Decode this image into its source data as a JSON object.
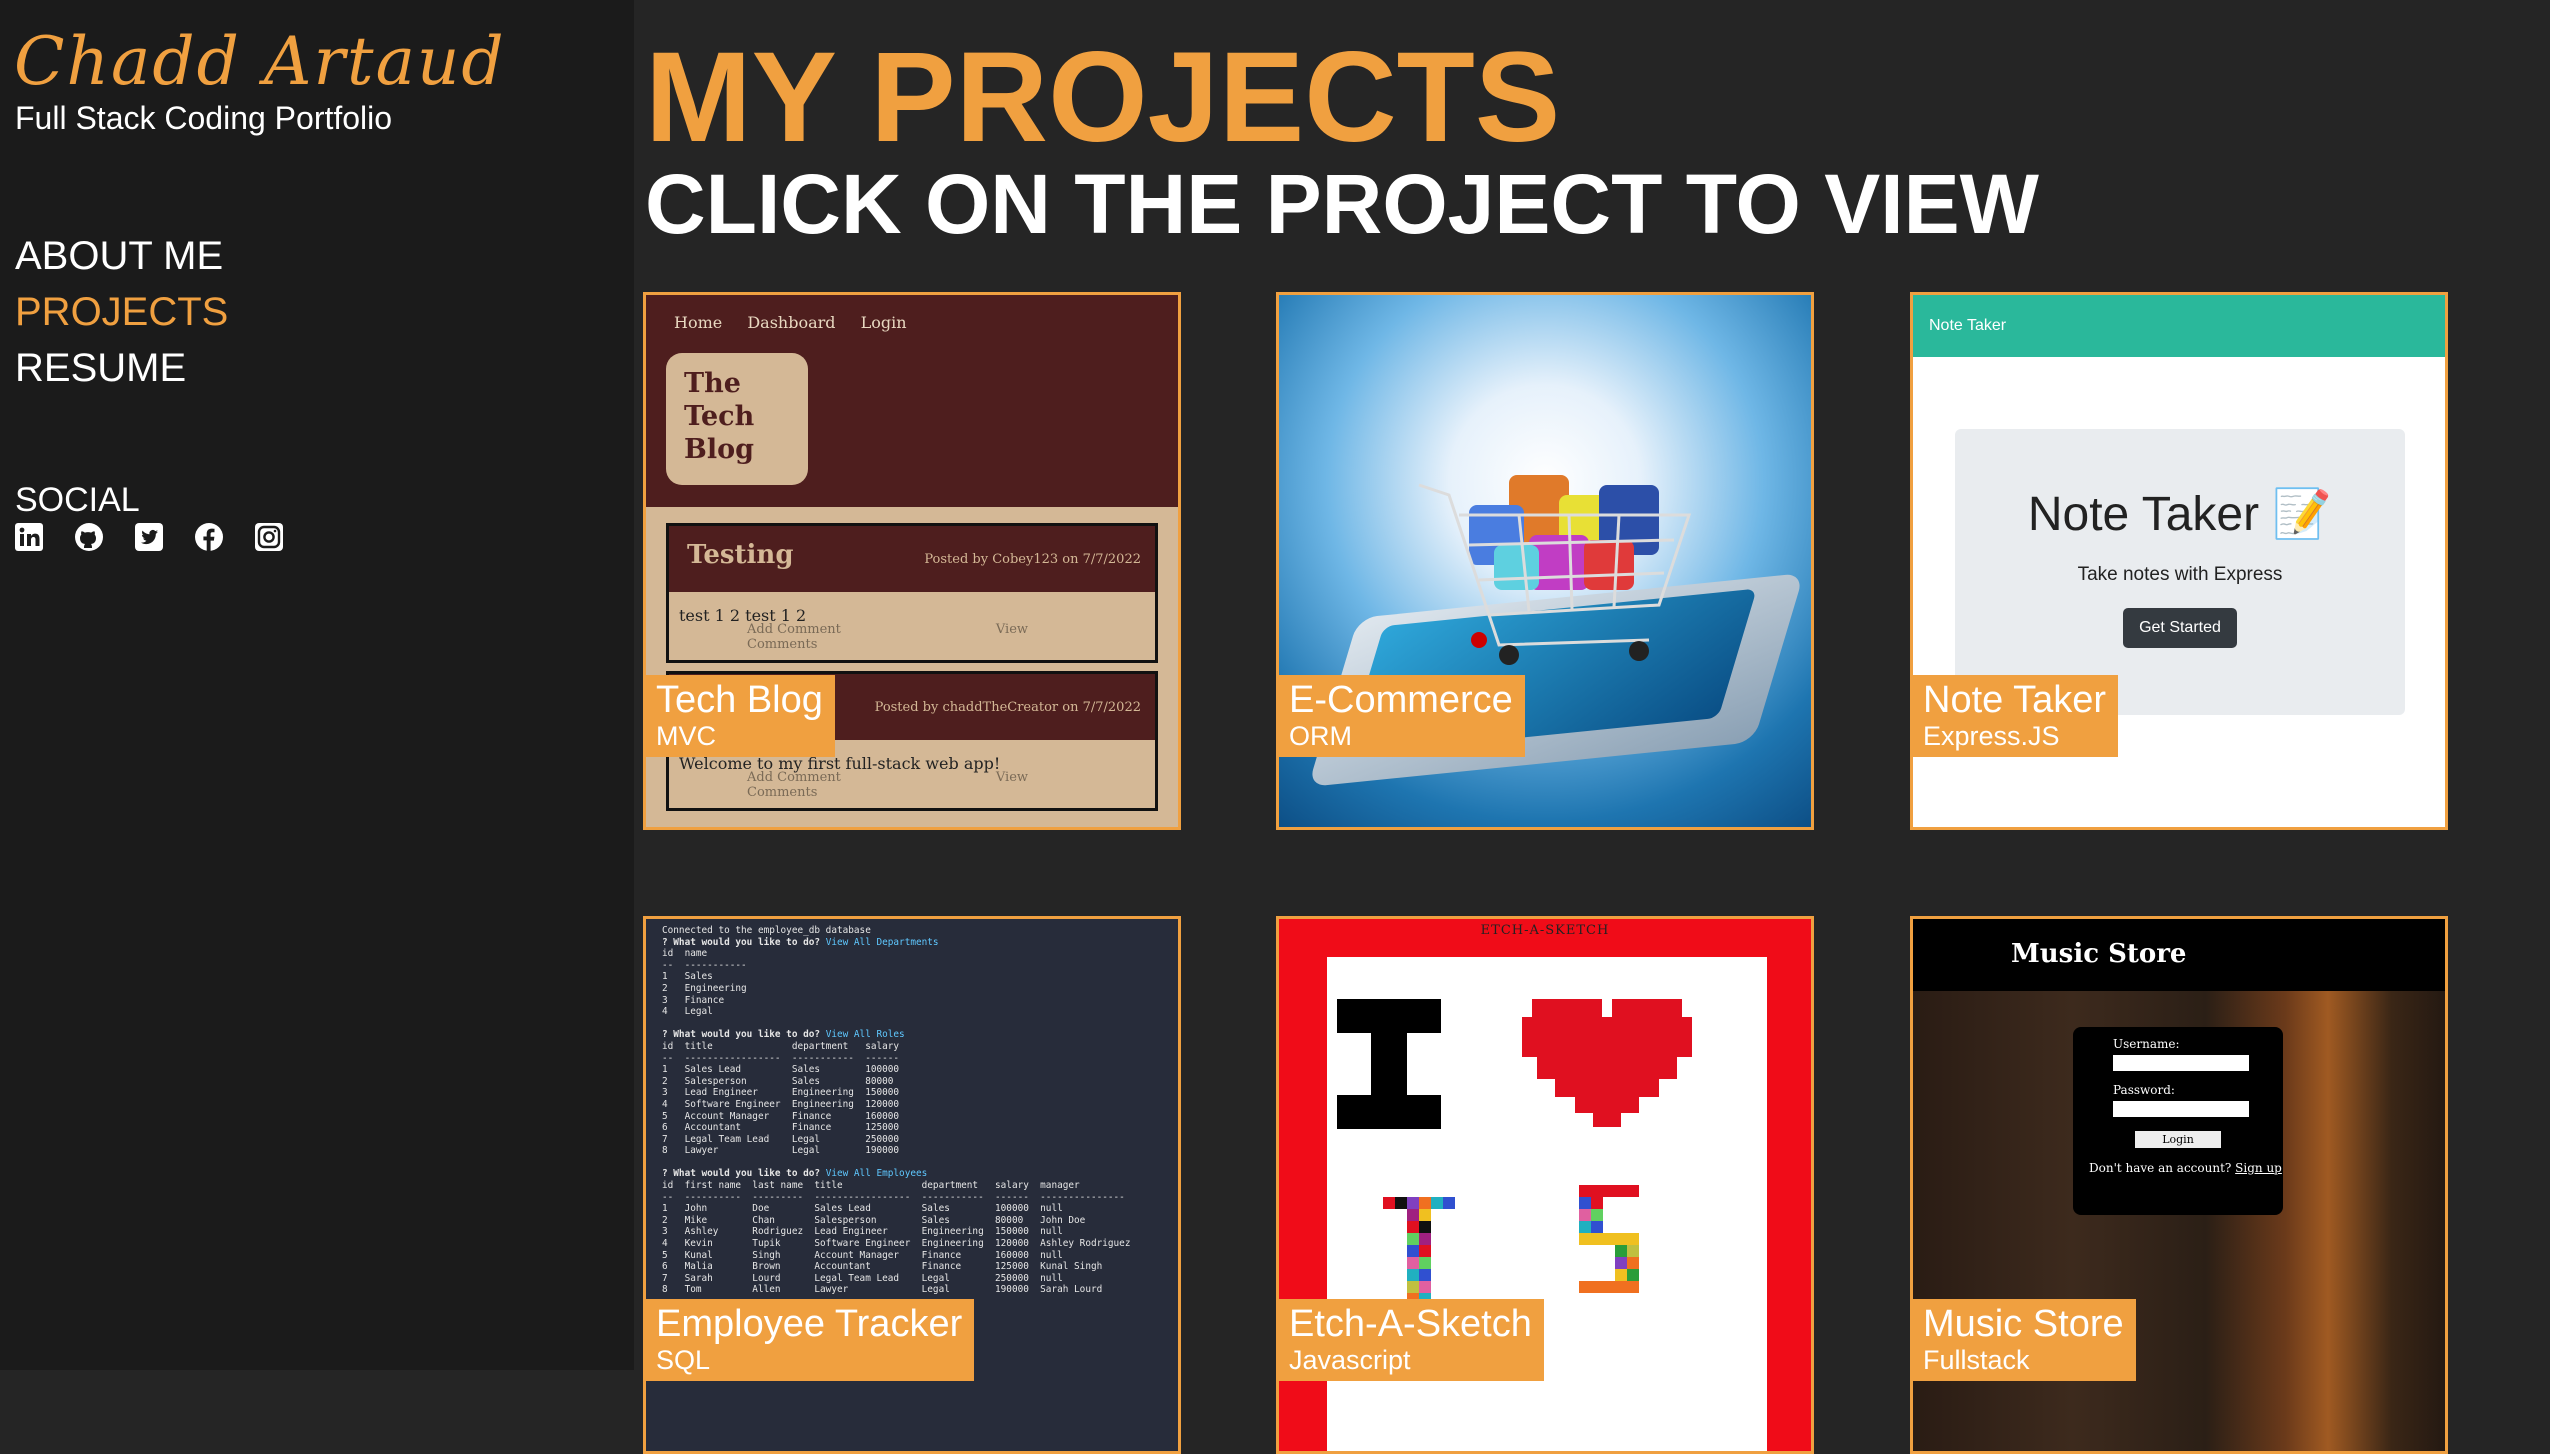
{
  "sidebar": {
    "brand_name": "Chadd Artaud",
    "tagline": "Full Stack Coding Portfolio",
    "nav": [
      {
        "label": "ABOUT ME",
        "active": false
      },
      {
        "label": "PROJECTS",
        "active": true
      },
      {
        "label": "RESUME",
        "active": false
      }
    ],
    "social_title": "SOCIAL",
    "social_icons": [
      "linkedin-icon",
      "github-icon",
      "twitter-icon",
      "facebook-icon",
      "instagram-icon"
    ]
  },
  "main": {
    "title": "MY PROJECTS",
    "subtitle": "CLICK ON THE PROJECT TO VIEW",
    "projects": [
      {
        "name": "Tech Blog",
        "tech": "MVC",
        "preview": {
          "nav": [
            "Home",
            "Dashboard",
            "Login"
          ],
          "logo": "The Tech Blog",
          "posts": [
            {
              "title": "Testing",
              "meta": "Posted by Cobey123 on 7/7/2022",
              "body": "test 1 2 test 1 2",
              "links": [
                "Add Comment",
                "View Comments"
              ]
            },
            {
              "title": "",
              "meta": "Posted by chaddTheCreator on 7/7/2022",
              "body": "Welcome to my first full-stack web app!",
              "links": [
                "Add Comment",
                "View Comments"
              ]
            }
          ]
        }
      },
      {
        "name": "E-Commerce",
        "tech": "ORM"
      },
      {
        "name": "Note Taker",
        "tech": "Express.JS",
        "preview": {
          "bar": "Note Taker",
          "heading": "Note Taker 📝",
          "text": "Take notes with Express",
          "button": "Get Started"
        }
      },
      {
        "name": "Employee Tracker",
        "tech": "SQL",
        "preview": {
          "lines": [
            "Connected to the employee_db database",
            "? What would you like to do? View All Departments",
            "id  name",
            "--  -----------",
            "1   Sales",
            "2   Engineering",
            "3   Finance",
            "4   Legal",
            "",
            "? What would you like to do? View All Roles",
            "id  title              department   salary",
            "--  -----------------  -----------  ------",
            "1   Sales Lead         Sales        100000",
            "2   Salesperson        Sales        80000",
            "3   Lead Engineer      Engineering  150000",
            "4   Software Engineer  Engineering  120000",
            "5   Account Manager    Finance      160000",
            "6   Accountant         Finance      125000",
            "7   Legal Team Lead    Legal        250000",
            "8   Lawyer             Legal        190000",
            "",
            "? What would you like to do? View All Employees",
            "id  first name  last name  title              department   salary  manager",
            "--  ----------  ---------  -----------------  -----------  ------  ---------------",
            "1   John        Doe        Sales Lead         Sales        100000  null",
            "2   Mike        Chan       Salesperson        Sales        80000   John Doe",
            "3   Ashley      Rodriguez  Lead Engineer      Engineering  150000  null",
            "4   Kevin       Tupik      Software Engineer  Engineering  120000  Ashley Rodriguez",
            "5   Kunal       Singh      Account Manager    Finance      160000  null",
            "6   Malia       Brown      Accountant         Finance      125000  Kunal Singh",
            "7   Sarah       Lourd      Legal Team Lead    Legal        250000  null",
            "8   Tom         Allen      Lawyer             Legal        190000  Sarah Lourd"
          ]
        }
      },
      {
        "name": "Etch-A-Sketch",
        "tech": "Javascript",
        "preview": {
          "title": "ETCH-A-SKETCH"
        }
      },
      {
        "name": "Music Store",
        "tech": "Fullstack",
        "preview": {
          "header": "Music Store",
          "username_label": "Username:",
          "password_label": "Password:",
          "button": "Login",
          "signup_text": "Don't have an account?",
          "signup_link": "Sign up"
        }
      }
    ]
  },
  "colors": {
    "accent": "#f0a040",
    "background": "#252525",
    "sidebar": "#1b1b1b"
  }
}
